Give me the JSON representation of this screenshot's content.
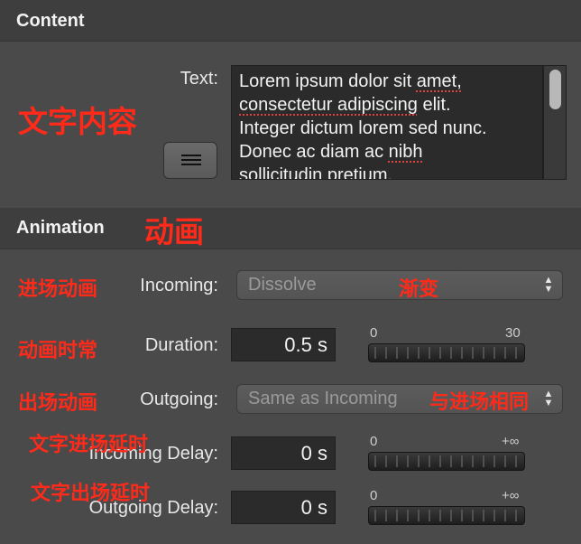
{
  "content": {
    "section_title": "Content",
    "annotation": "文字内容",
    "text_label": "Text:",
    "text_lines": [
      "Lorem ipsum dolor sit amet,",
      "consectetur adipiscing elit.",
      "Integer dictum lorem sed nunc.",
      "Donec ac diam ac nibh",
      "sollicitudin pretium."
    ]
  },
  "animation": {
    "section_title": "Animation",
    "annotation": "动画",
    "incoming": {
      "annotation": "进场动画",
      "label": "Incoming:",
      "value": "Dissolve",
      "value_annotation": "渐变"
    },
    "duration": {
      "annotation": "动画时常",
      "label": "Duration:",
      "value": "0.5 s",
      "min": "0",
      "max": "30"
    },
    "outgoing": {
      "annotation": "出场动画",
      "label": "Outgoing:",
      "value": "Same as Incoming",
      "value_annotation": "与进场相同"
    },
    "incoming_delay": {
      "annotation": "文字进场延时",
      "label": "Incoming Delay:",
      "value": "0 s",
      "min": "0",
      "max": "+∞"
    },
    "outgoing_delay": {
      "annotation": "文字出场延时",
      "label": "Outgoing Delay:",
      "value": "0 s",
      "min": "0",
      "max": "+∞"
    }
  },
  "colors": {
    "annotation_red": "#ff2a1a",
    "background": "#4a4a4a",
    "header": "#3e3e3e",
    "field": "#2b2b2b"
  },
  "icons": {
    "align_button": "text-align-icon",
    "popup_arrows": "up-down-chevron-icon"
  }
}
